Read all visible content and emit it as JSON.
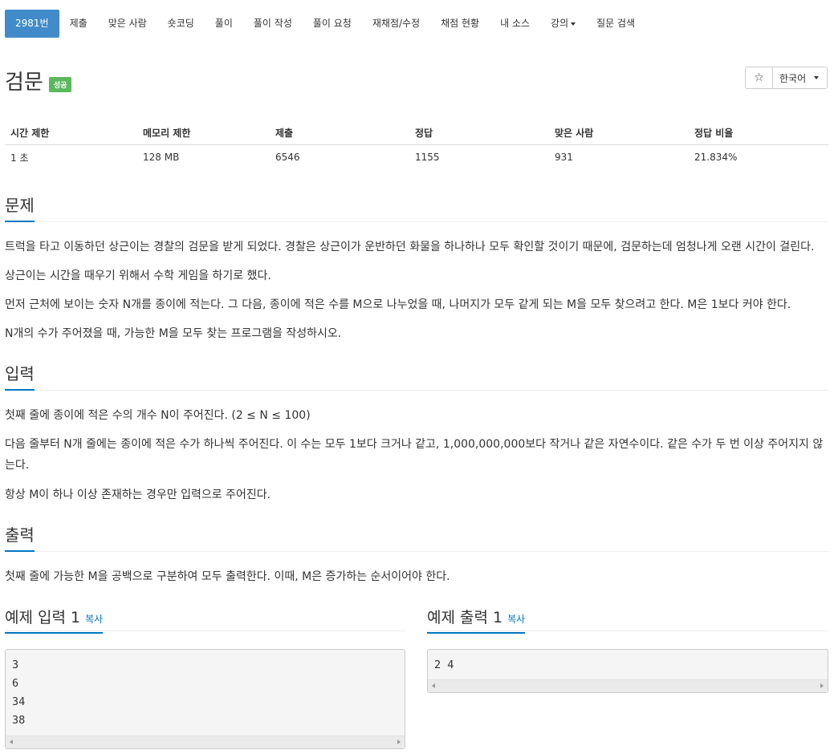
{
  "nav": {
    "items": [
      "2981번",
      "제출",
      "맞은 사람",
      "숏코딩",
      "풀이",
      "풀이 작성",
      "풀이 요청",
      "재채점/수정",
      "채점 현황",
      "내 소스",
      "강의",
      "질문 검색"
    ]
  },
  "problem": {
    "title": "검문",
    "status_badge": "성공",
    "star_icon": "☆",
    "language": "한국어"
  },
  "stats": {
    "headers": [
      "시간 제한",
      "메모리 제한",
      "제출",
      "정답",
      "맞은 사람",
      "정답 비율"
    ],
    "values": [
      "1 초",
      "128 MB",
      "6546",
      "1155",
      "931",
      "21.834%"
    ]
  },
  "sections": {
    "problem_heading": "문제",
    "problem_paragraphs": [
      "트럭을 타고 이동하던 상근이는 경찰의 검문을 받게 되었다. 경찰은 상근이가 운반하던 화물을 하나하나 모두 확인할 것이기 때문에, 검문하는데 엄청나게 오랜 시간이 걸린다.",
      "상근이는 시간을 때우기 위해서 수학 게임을 하기로 했다.",
      "먼저 근처에 보이는 숫자 N개를 종이에 적는다. 그 다음, 종이에 적은 수를 M으로 나누었을 때, 나머지가 모두 같게 되는 M을 모두 찾으려고 한다. M은 1보다 커야 한다.",
      "N개의 수가 주어졌을 때, 가능한 M을 모두 찾는 프로그램을 작성하시오."
    ],
    "input_heading": "입력",
    "input_paragraphs": [
      "첫째 줄에 종이에 적은 수의 개수 N이 주어진다. (2 ≤ N ≤ 100)",
      "다음 줄부터 N개 줄에는 종이에 적은 수가 하나씩 주어진다. 이 수는 모두 1보다 크거나 같고, 1,000,000,000보다 작거나 같은 자연수이다. 같은 수가 두 번 이상 주어지지 않는다.",
      "항상 M이 하나 이상 존재하는 경우만 입력으로 주어진다."
    ],
    "output_heading": "출력",
    "output_paragraphs": [
      "첫째 줄에 가능한 M을 공백으로 구분하여 모두 출력한다. 이때, M은 증가하는 순서이어야 한다."
    ]
  },
  "samples": {
    "input_title": "예제 입력 1",
    "output_title": "예제 출력 1",
    "copy_label": "복사",
    "input_lines": [
      "3",
      "6",
      "34",
      "38"
    ],
    "output_lines": [
      "2 4"
    ]
  }
}
